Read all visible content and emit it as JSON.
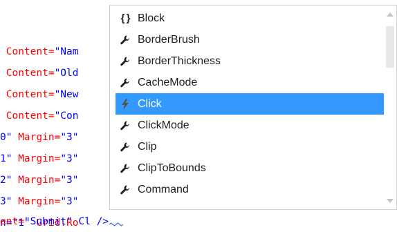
{
  "editor": {
    "lines": [
      {
        "pre": " ",
        "attr": "Content=",
        "val": "\"Nam"
      },
      {
        "pre": " ",
        "attr": "Content=",
        "val": "\"Old"
      },
      {
        "pre": " ",
        "attr": "Content=",
        "val": "\"New"
      },
      {
        "pre": " ",
        "attr": "Content=",
        "val": "\"Con"
      },
      {
        "pre": "0\" ",
        "attr": "Margin=",
        "val": "\"3\""
      },
      {
        "pre": "1\" ",
        "attr": "Margin=",
        "val": "\"3\""
      },
      {
        "pre": "2\" ",
        "attr": "Margin=",
        "val": "\"3\""
      },
      {
        "pre": "3\" ",
        "attr": "Margin=",
        "val": "\"3\""
      },
      {
        "pre": "n=\"1\" ",
        "attr": "Grid.Ro",
        "val": ""
      },
      {
        "pre": "ent=",
        "attr": "",
        "val": "\"Submit\" Cl />"
      }
    ]
  },
  "autocomplete": {
    "selected_index": 4,
    "items": [
      {
        "label": "Block",
        "icon": "braces-icon"
      },
      {
        "label": "BorderBrush",
        "icon": "wrench-icon"
      },
      {
        "label": "BorderThickness",
        "icon": "wrench-icon"
      },
      {
        "label": "CacheMode",
        "icon": "wrench-icon"
      },
      {
        "label": "Click",
        "icon": "event-lightning-icon"
      },
      {
        "label": "ClickMode",
        "icon": "wrench-icon"
      },
      {
        "label": "Clip",
        "icon": "wrench-icon"
      },
      {
        "label": "ClipToBounds",
        "icon": "wrench-icon"
      },
      {
        "label": "Command",
        "icon": "wrench-icon"
      }
    ]
  },
  "colors": {
    "selection": "#3399ff",
    "attribute": "#ff0000",
    "value": "#0000ff"
  }
}
